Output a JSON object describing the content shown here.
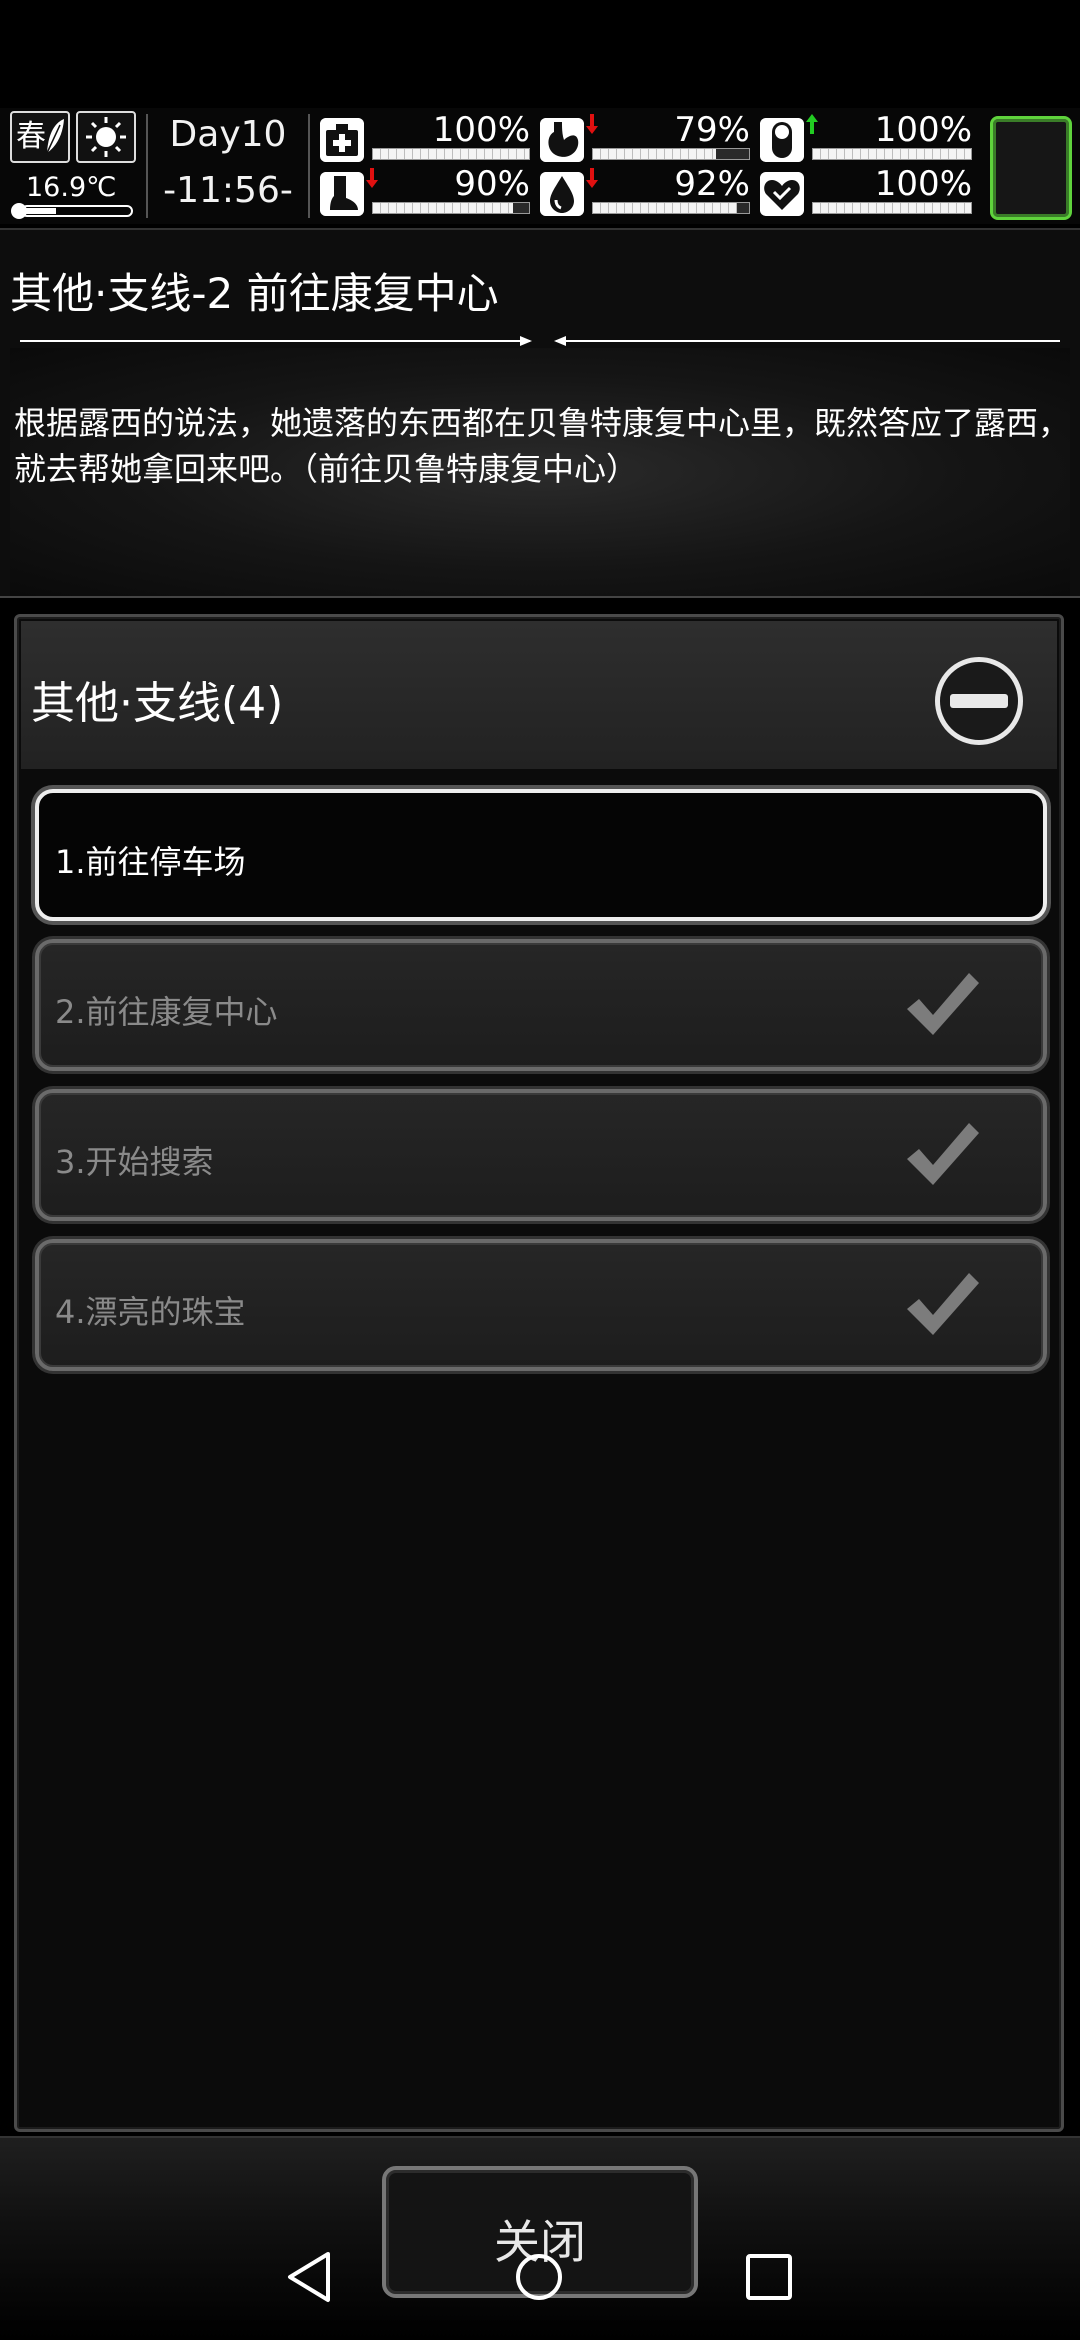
{
  "hud": {
    "season": "春",
    "temperature": "16.9℃",
    "day": "Day10",
    "time": "-11:56-",
    "stats": [
      {
        "name": "health",
        "value": "100%",
        "level": 1.0,
        "arrow": "none"
      },
      {
        "name": "stomach",
        "value": "79%",
        "level": 0.79,
        "arrow": "down"
      },
      {
        "name": "medicine",
        "value": "100%",
        "level": 1.0,
        "arrow": "up"
      },
      {
        "name": "stamina",
        "value": "90%",
        "level": 0.9,
        "arrow": "down"
      },
      {
        "name": "water",
        "value": "92%",
        "level": 0.92,
        "arrow": "down"
      },
      {
        "name": "mood",
        "value": "100%",
        "level": 1.0,
        "arrow": "none"
      }
    ],
    "colors": {
      "arrow_down": "#e01010",
      "arrow_up": "#22cc22",
      "status_border": "#5fd33c"
    }
  },
  "quest": {
    "title": "其他·支线-2 前往康复中心",
    "description": "根据露西的说法，她遗落的东西都在贝鲁特康复中心里，既然答应了露西，就去帮她拿回来吧。（前往贝鲁特康复中心）"
  },
  "category": {
    "title": "其他·支线(4)",
    "items": [
      {
        "label": "1.前往停车场",
        "status": "active"
      },
      {
        "label": "2.前往康复中心",
        "status": "done"
      },
      {
        "label": "3.开始搜索",
        "status": "done"
      },
      {
        "label": "4.漂亮的珠宝",
        "status": "done"
      }
    ]
  },
  "footer": {
    "close_label": "关闭"
  },
  "icons": [
    "leaf-icon",
    "sun-icon",
    "thermometer-icon",
    "first-aid-icon",
    "stomach-icon",
    "pill-icon",
    "foot-icon",
    "water-drop-icon",
    "heart-icon",
    "minus-icon",
    "checkmark-icon",
    "nav-back-icon",
    "nav-home-icon",
    "nav-recent-icon"
  ]
}
